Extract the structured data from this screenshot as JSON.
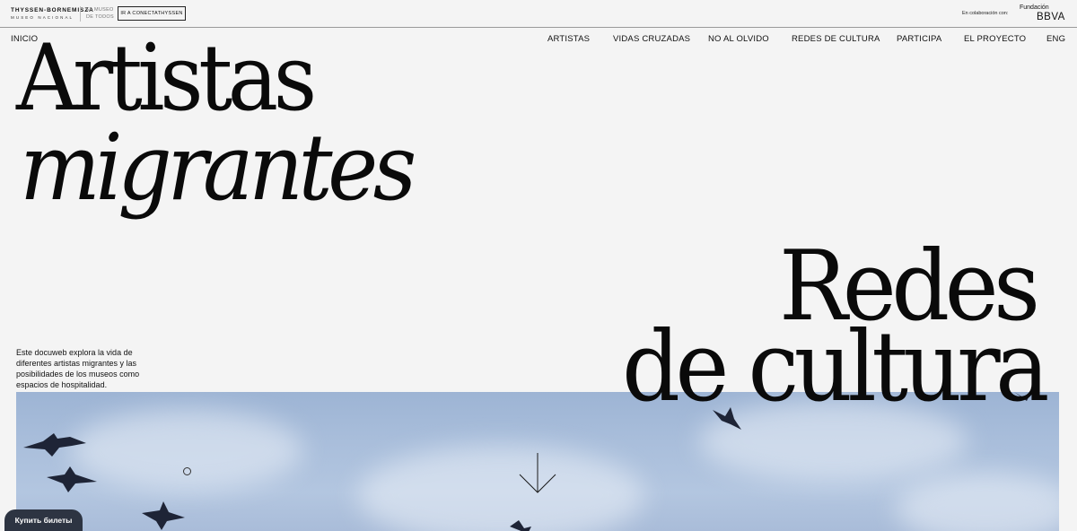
{
  "header": {
    "logo_line1": "THYSSEN-BORNEMISZA",
    "logo_line2": "MUSEO NACIONAL",
    "motto_line1": "EL MUSEO",
    "motto_line2": "DE TODOS",
    "connect_label": "IR A CONECTATHYSSEN",
    "collab_label": "En colaboración con:",
    "sponsor_line1": "Fundación",
    "sponsor_line2": "BBVA"
  },
  "nav": {
    "home": "INICIO",
    "items": [
      "ARTISTAS",
      "VIDAS CRUZADAS",
      "NO AL OLVIDO",
      "REDES DE CULTURA",
      "PARTICIPA",
      "EL PROYECTO",
      "ENG"
    ]
  },
  "hero": {
    "title_line1": "Artistas",
    "title_line2": "migrantes",
    "section_line1": "Redes",
    "section_line2": "de cultura",
    "intro": "Este docuweb explora la vida de diferentes artistas migrantes y las posibilidades de los museos como espacios de hospitalidad."
  },
  "floating": {
    "ticket_label": "Купить билеты"
  },
  "colors": {
    "background": "#f4f4f4",
    "sky": "#a9bedb",
    "ticket_button": "#2d3442",
    "text": "#0a0a0a"
  }
}
